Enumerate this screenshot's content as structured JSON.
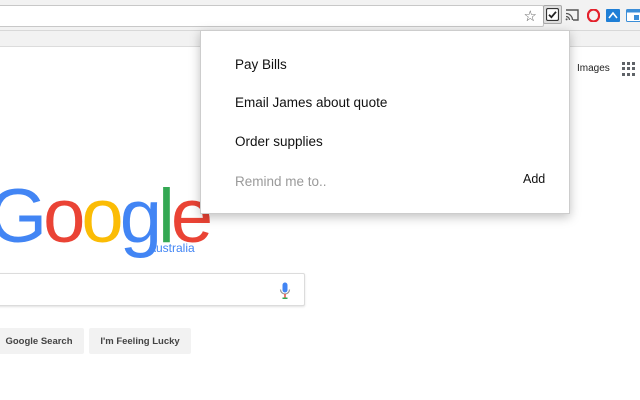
{
  "browser": {
    "extensions": [
      "reminder-check-icon",
      "cast-icon",
      "opera-icon",
      "tab-save-icon",
      "window-icon"
    ]
  },
  "google": {
    "images_link": "Images",
    "logo_letters": [
      {
        "char": "G",
        "color": "#4285f4"
      },
      {
        "char": "o",
        "color": "#ea4335"
      },
      {
        "char": "o",
        "color": "#fbbc05"
      },
      {
        "char": "g",
        "color": "#4285f4"
      },
      {
        "char": "l",
        "color": "#34a853"
      },
      {
        "char": "e",
        "color": "#ea4335"
      }
    ],
    "region": "Australia",
    "search_button": "Google Search",
    "lucky_button": "I'm Feeling Lucky"
  },
  "popup": {
    "items": [
      {
        "label": "Pay Bills"
      },
      {
        "label": "Email James about quote"
      },
      {
        "label": "Order supplies"
      }
    ],
    "input_placeholder": "Remind me to..",
    "input_value": "",
    "add_label": "Add"
  }
}
